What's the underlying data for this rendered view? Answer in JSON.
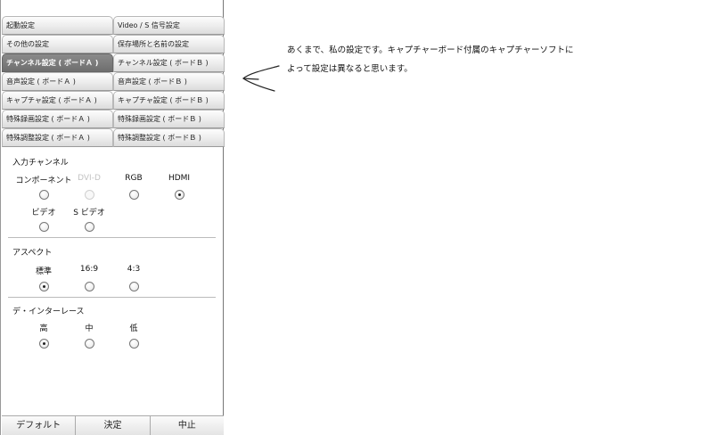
{
  "tabs": [
    [
      "起動設定",
      "Video / S 信号設定"
    ],
    [
      "その他の設定",
      "保存場所と名前の設定"
    ],
    [
      "チャンネル設定 ( ボードＡ )",
      "チャンネル設定 ( ボードＢ )"
    ],
    [
      "音声設定 ( ボードＡ )",
      "音声設定 ( ボードＢ )"
    ],
    [
      "キャプチャ設定 ( ボードＡ )",
      "キャプチャ設定 ( ボードＢ )"
    ],
    [
      "特殊録画設定 ( ボードＡ )",
      "特殊録画設定 ( ボードＢ )"
    ],
    [
      "特殊調整設定 ( ボードＡ )",
      "特殊調整設定 ( ボードＢ )"
    ]
  ],
  "active_tab": "チャンネル設定 ( ボードＡ )",
  "input_channel": {
    "title": "入力チャンネル",
    "options": [
      {
        "label": "コンポーネント",
        "checked": false,
        "disabled": false
      },
      {
        "label": "DVI-D",
        "checked": false,
        "disabled": true
      },
      {
        "label": "RGB",
        "checked": false,
        "disabled": false
      },
      {
        "label": "HDMI",
        "checked": true,
        "disabled": false
      },
      {
        "label": "ビデオ",
        "checked": false,
        "disabled": false
      },
      {
        "label": "S ビデオ",
        "checked": false,
        "disabled": false
      }
    ]
  },
  "aspect": {
    "title": "アスペクト",
    "options": [
      {
        "label": "標準",
        "checked": true
      },
      {
        "label": "16:9",
        "checked": false
      },
      {
        "label": "4:3",
        "checked": false
      }
    ]
  },
  "deinterlace": {
    "title": "デ・インターレース",
    "options": [
      {
        "label": "高",
        "checked": true
      },
      {
        "label": "中",
        "checked": false
      },
      {
        "label": "低",
        "checked": false
      }
    ]
  },
  "footer": {
    "default_label": "デフォルト",
    "ok_label": "決定",
    "cancel_label": "中止"
  },
  "note": {
    "line1": "あくまで、私の設定です。キャプチャーボード付属のキャプチャーソフトに",
    "line2": "よって設定は異なると思います。"
  }
}
